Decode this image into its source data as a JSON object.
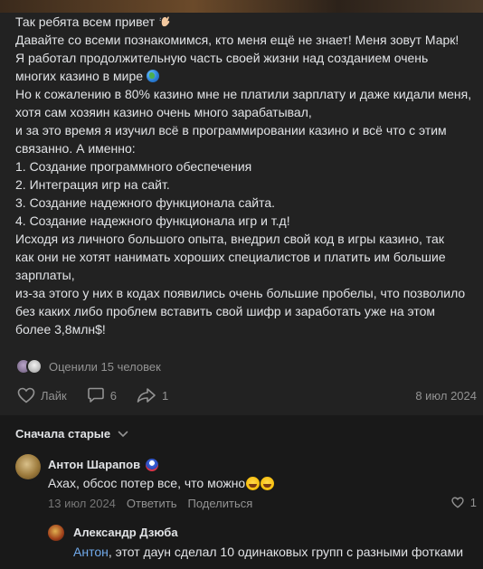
{
  "post": {
    "lines_p1": [
      "Так ребята всем привет",
      "Давайте со всеми познакомимся, кто меня ещё не знает! Меня зовут Марк!",
      "Я работал продолжительную часть своей жизни над созданием очень",
      "многих казино в мире",
      "Но к сожалению в 80% казино мне не платили зарплату и даже кидали меня,",
      "хотя сам хозяин казино очень много зарабатывал,",
      "и за это время я изучил всё в программировании казино и всё что с этим",
      "связанно. А именно:",
      "1. Создание программного обеспечения",
      "2. Интеграция игр на сайт.",
      "3. Создание надежного функционала сайта.",
      "4. Создание надежного функционала игр и т.д!"
    ],
    "lines_p2": [
      "Исходя из личного большого опыта, внедрил свой код в игры казино, так",
      "как они не хотят нанимать хороших специалистов и платить им большие",
      "зарплаты,",
      "из-за этого у них в кодах появились очень большие пробелы, что позволило",
      "без каких либо проблем вставить свой шифр и заработать уже на этом",
      "более 3,8млн$!"
    ],
    "emoji_wave": "waving-hand-icon",
    "emoji_globe": "globe-icon"
  },
  "reactions": {
    "text": "Оценили 15 человек"
  },
  "actions": {
    "like_label": "Лайк",
    "comments_count": "6",
    "shares_count": "1",
    "date": "8 июл 2024"
  },
  "comments": {
    "sort_label": "Сначала старые",
    "first": {
      "author": "Антон Шарапов",
      "text": "Ахах, обсос потер все, что можно",
      "date": "13 июл 2024",
      "reply_label": "Ответить",
      "share_label": "Поделиться",
      "likes": "1"
    },
    "reply": {
      "author": "Александр Дзюба",
      "mention": "Антон",
      "text": ", этот даун сделал 10 одинаковых групп с разными фотками"
    }
  },
  "colors": {
    "background": "#191919",
    "card": "#222222",
    "text": "#e1e3e6",
    "muted": "#939393",
    "link": "#71aaeb"
  }
}
